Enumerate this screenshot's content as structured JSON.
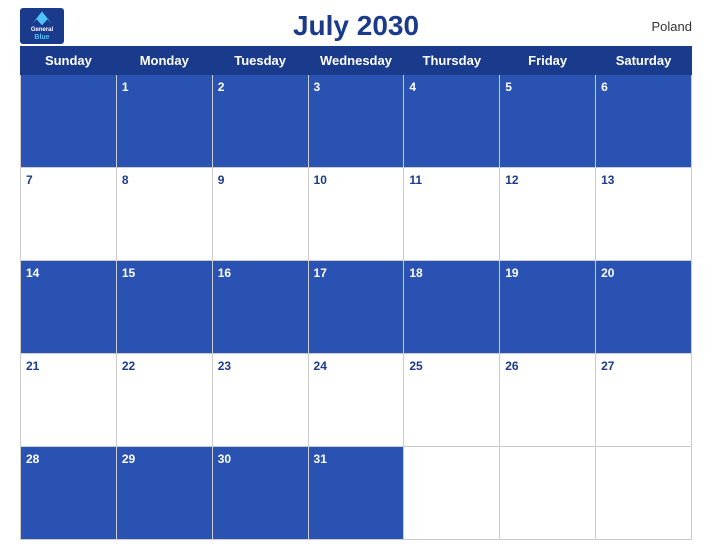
{
  "header": {
    "title": "July 2030",
    "country": "Poland",
    "logo_general": "General",
    "logo_blue": "Blue"
  },
  "days_of_week": [
    "Sunday",
    "Monday",
    "Tuesday",
    "Wednesday",
    "Thursday",
    "Friday",
    "Saturday"
  ],
  "weeks": [
    [
      null,
      1,
      2,
      3,
      4,
      5,
      6
    ],
    [
      7,
      8,
      9,
      10,
      11,
      12,
      13
    ],
    [
      14,
      15,
      16,
      17,
      18,
      19,
      20
    ],
    [
      21,
      22,
      23,
      24,
      25,
      26,
      27
    ],
    [
      28,
      29,
      30,
      31,
      null,
      null,
      null
    ]
  ]
}
